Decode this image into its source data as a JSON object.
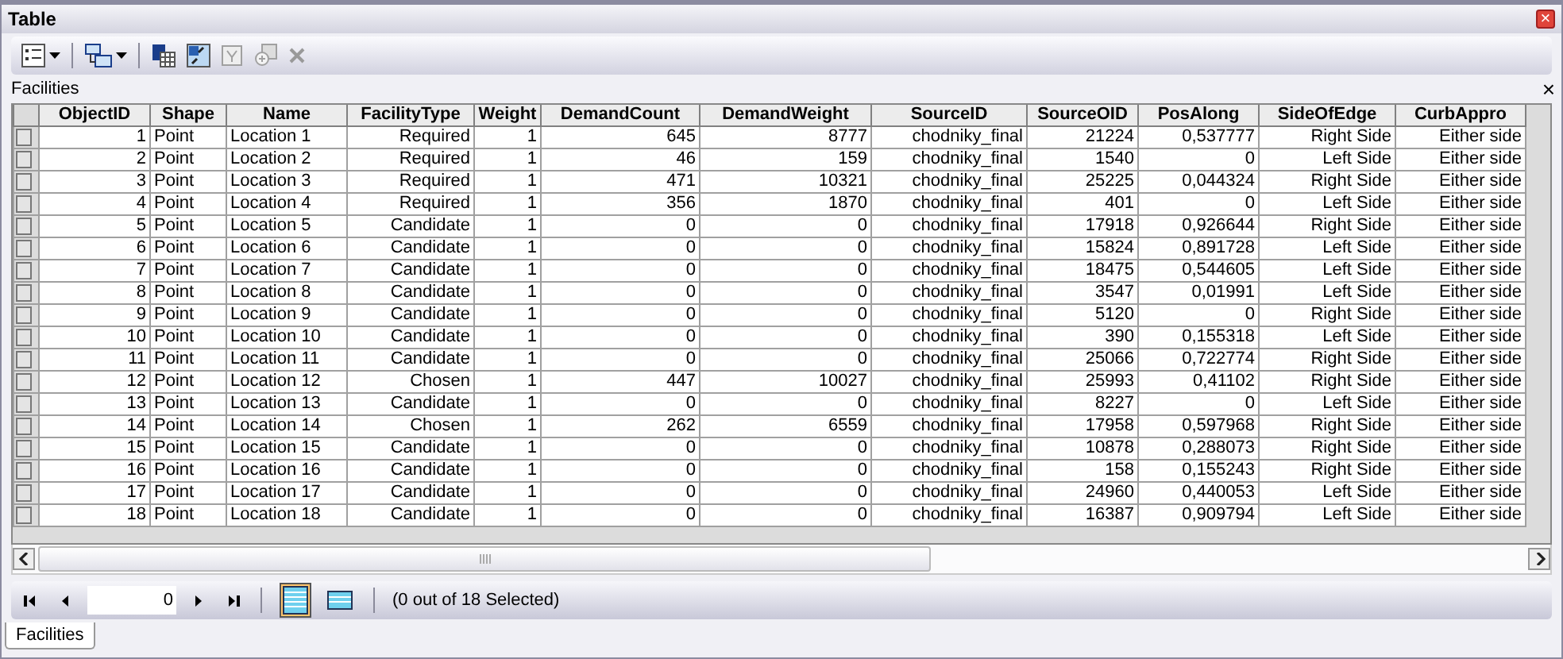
{
  "window": {
    "title": "Table",
    "close": "×"
  },
  "toolbar": [
    {
      "kind": "options",
      "dropdown": true,
      "disabled": false
    },
    {
      "kind": "related",
      "dropdown": true,
      "disabled": false
    },
    {
      "kind": "select-by-attributes",
      "dropdown": false,
      "disabled": false
    },
    {
      "kind": "switch-selection",
      "dropdown": false,
      "disabled": false
    },
    {
      "kind": "clear-selection",
      "dropdown": false,
      "disabled": true
    },
    {
      "kind": "zoom-selected",
      "dropdown": false,
      "disabled": true
    },
    {
      "kind": "delete",
      "dropdown": false,
      "disabled": true
    }
  ],
  "table_title": {
    "text": "Facilities",
    "close": "×"
  },
  "table": {
    "columns": [
      "ObjectID",
      "Shape",
      "Name",
      "FacilityType",
      "Weight",
      "DemandCount",
      "DemandWeight",
      "SourceID",
      "SourceOID",
      "PosAlong",
      "SideOfEdge",
      "CurbAppro"
    ],
    "rows": [
      {
        "selected": false,
        "cells": [
          "1",
          "Point",
          "Location 1",
          "Required",
          "1",
          "645",
          "8777",
          "chodniky_final",
          "21224",
          "0,537777",
          "Right Side",
          "Either side"
        ]
      },
      {
        "selected": false,
        "cells": [
          "2",
          "Point",
          "Location 2",
          "Required",
          "1",
          "46",
          "159",
          "chodniky_final",
          "1540",
          "0",
          "Left Side",
          "Either side"
        ]
      },
      {
        "selected": false,
        "cells": [
          "3",
          "Point",
          "Location 3",
          "Required",
          "1",
          "471",
          "10321",
          "chodniky_final",
          "25225",
          "0,044324",
          "Right Side",
          "Either side"
        ]
      },
      {
        "selected": false,
        "cells": [
          "4",
          "Point",
          "Location 4",
          "Required",
          "1",
          "356",
          "1870",
          "chodniky_final",
          "401",
          "0",
          "Left Side",
          "Either side"
        ]
      },
      {
        "selected": false,
        "cells": [
          "5",
          "Point",
          "Location 5",
          "Candidate",
          "1",
          "0",
          "0",
          "chodniky_final",
          "17918",
          "0,926644",
          "Right Side",
          "Either side"
        ]
      },
      {
        "selected": false,
        "cells": [
          "6",
          "Point",
          "Location 6",
          "Candidate",
          "1",
          "0",
          "0",
          "chodniky_final",
          "15824",
          "0,891728",
          "Left Side",
          "Either side"
        ]
      },
      {
        "selected": false,
        "cells": [
          "7",
          "Point",
          "Location 7",
          "Candidate",
          "1",
          "0",
          "0",
          "chodniky_final",
          "18475",
          "0,544605",
          "Left Side",
          "Either side"
        ]
      },
      {
        "selected": false,
        "cells": [
          "8",
          "Point",
          "Location 8",
          "Candidate",
          "1",
          "0",
          "0",
          "chodniky_final",
          "3547",
          "0,01991",
          "Left Side",
          "Either side"
        ]
      },
      {
        "selected": false,
        "cells": [
          "9",
          "Point",
          "Location 9",
          "Candidate",
          "1",
          "0",
          "0",
          "chodniky_final",
          "5120",
          "0",
          "Right Side",
          "Either side"
        ]
      },
      {
        "selected": false,
        "cells": [
          "10",
          "Point",
          "Location 10",
          "Candidate",
          "1",
          "0",
          "0",
          "chodniky_final",
          "390",
          "0,155318",
          "Left Side",
          "Either side"
        ]
      },
      {
        "selected": false,
        "cells": [
          "11",
          "Point",
          "Location 11",
          "Candidate",
          "1",
          "0",
          "0",
          "chodniky_final",
          "25066",
          "0,722774",
          "Right Side",
          "Either side"
        ]
      },
      {
        "selected": false,
        "cells": [
          "12",
          "Point",
          "Location 12",
          "Chosen",
          "1",
          "447",
          "10027",
          "chodniky_final",
          "25993",
          "0,41102",
          "Right Side",
          "Either side"
        ]
      },
      {
        "selected": false,
        "cells": [
          "13",
          "Point",
          "Location 13",
          "Candidate",
          "1",
          "0",
          "0",
          "chodniky_final",
          "8227",
          "0",
          "Left Side",
          "Either side"
        ]
      },
      {
        "selected": false,
        "cells": [
          "14",
          "Point",
          "Location 14",
          "Chosen",
          "1",
          "262",
          "6559",
          "chodniky_final",
          "17958",
          "0,597968",
          "Right Side",
          "Either side"
        ]
      },
      {
        "selected": false,
        "cells": [
          "15",
          "Point",
          "Location 15",
          "Candidate",
          "1",
          "0",
          "0",
          "chodniky_final",
          "10878",
          "0,288073",
          "Right Side",
          "Either side"
        ]
      },
      {
        "selected": false,
        "cells": [
          "16",
          "Point",
          "Location 16",
          "Candidate",
          "1",
          "0",
          "0",
          "chodniky_final",
          "158",
          "0,155243",
          "Right Side",
          "Either side"
        ]
      },
      {
        "selected": false,
        "cells": [
          "17",
          "Point",
          "Location 17",
          "Candidate",
          "1",
          "0",
          "0",
          "chodniky_final",
          "24960",
          "0,440053",
          "Left Side",
          "Either side"
        ]
      },
      {
        "selected": false,
        "cells": [
          "18",
          "Point",
          "Location 18",
          "Candidate",
          "1",
          "0",
          "0",
          "chodniky_final",
          "16387",
          "0,909794",
          "Left Side",
          "Either side"
        ]
      }
    ]
  },
  "navigator": {
    "record": "0",
    "views": [
      {
        "kind": "all",
        "selected": true
      },
      {
        "kind": "selected",
        "selected": false
      }
    ],
    "status": "(0 out of 18 Selected)"
  },
  "tabs": [
    {
      "label": "Facilities",
      "selected": true
    }
  ]
}
